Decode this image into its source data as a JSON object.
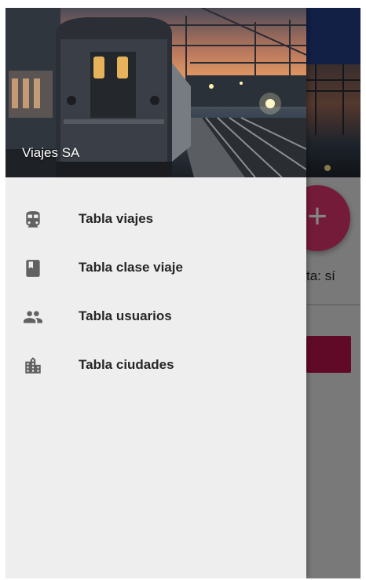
{
  "drawer": {
    "title": "Viajes SA",
    "items": [
      {
        "label": "Tabla viajes",
        "icon": "train-icon"
      },
      {
        "label": "Tabla clase viaje",
        "icon": "bookmark-icon"
      },
      {
        "label": "Tabla usuarios",
        "icon": "people-icon"
      },
      {
        "label": "Tabla ciudades",
        "icon": "city-icon"
      }
    ]
  },
  "background": {
    "text_fragment": "ta: sí",
    "fab_label": "+"
  },
  "colors": {
    "app_bar": "#243e86",
    "accent": "#e1356f",
    "button": "#b9154c",
    "icon": "#616161"
  }
}
